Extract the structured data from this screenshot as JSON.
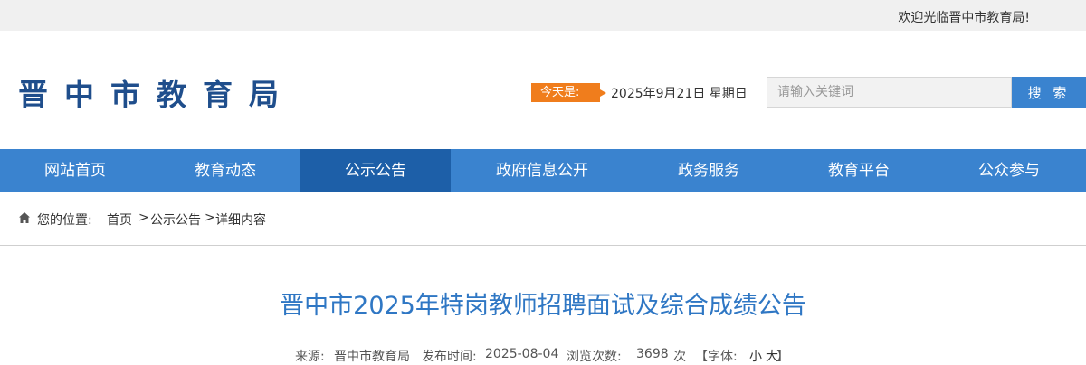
{
  "topbar": {
    "welcome": "欢迎光临晋中市教育局!"
  },
  "header": {
    "logo": "晋中市教育局",
    "today_label": "今天是:",
    "date": "2025年9月21日 星期日",
    "search_placeholder": "请输入关键词",
    "search_button": "搜 索"
  },
  "nav": {
    "items": [
      {
        "label": "网站首页"
      },
      {
        "label": "教育动态"
      },
      {
        "label": "公示公告"
      },
      {
        "label": "政府信息公开"
      },
      {
        "label": "政务服务"
      },
      {
        "label": "教育平台"
      },
      {
        "label": "公众参与"
      }
    ],
    "active_index": 2
  },
  "breadcrumb": {
    "label": "您的位置:",
    "home": "首页",
    "sep": ">",
    "category": "公示公告",
    "current": "详细内容"
  },
  "article": {
    "title": "晋中市2025年特岗教师招聘面试及综合成绩公告",
    "source_label": "来源:",
    "source": "晋中市教育局",
    "date_label": "发布时间:",
    "date": "2025-08-04",
    "views_label": "浏览次数:",
    "views": "3698",
    "views_unit": "次",
    "font_label": "【字体:",
    "font_small": "小",
    "font_large": "大",
    "font_close": "】"
  },
  "colors": {
    "accent": "#3a83cf",
    "nav_active": "#1d5fa8",
    "logo": "#1f4e8c",
    "today_tag": "#f07d1c",
    "title": "#2f77c4"
  }
}
